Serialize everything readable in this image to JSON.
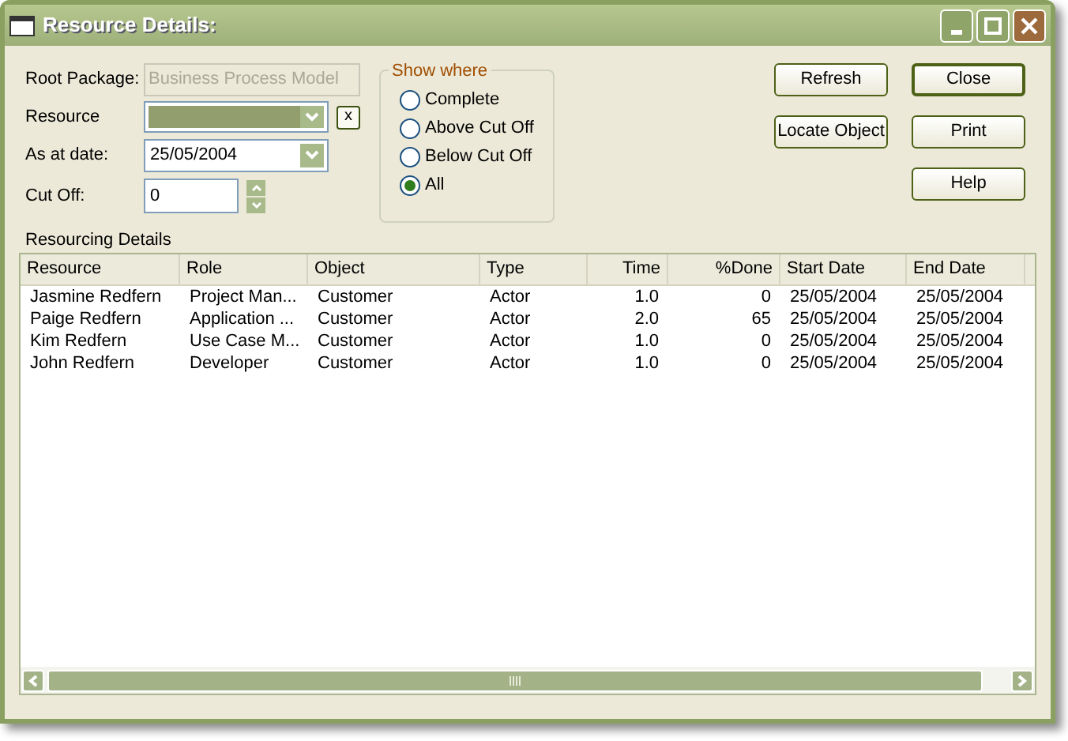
{
  "window": {
    "title": "Resource Details:"
  },
  "root_package": {
    "label": "Root Package:",
    "value": "Business Process Model",
    "disabled": true
  },
  "resource": {
    "label": "Resource",
    "clear_button": "x"
  },
  "as_at_date": {
    "label": "As at date:",
    "value": "25/05/2004"
  },
  "cut_off": {
    "label": "Cut Off:",
    "value": "0"
  },
  "show_where": {
    "title": "Show where",
    "options": [
      {
        "label": "Complete",
        "selected": false
      },
      {
        "label": "Above Cut Off",
        "selected": false
      },
      {
        "label": "Below Cut Off",
        "selected": false
      },
      {
        "label": "All",
        "selected": true
      }
    ]
  },
  "buttons": [
    {
      "label": "Refresh",
      "default": false
    },
    {
      "label": "Close",
      "default": true
    },
    {
      "label": "Locate Object",
      "default": false
    },
    {
      "label": "Print",
      "default": false
    },
    {
      "label": "Help",
      "default": false
    }
  ],
  "section_label": "Resourcing Details",
  "table": {
    "columns": [
      "Resource",
      "Role",
      "Object",
      "Type",
      "Time",
      "%Done",
      "Start Date",
      "End Date"
    ],
    "rows": [
      [
        "Jasmine Redfern",
        "Project Man...",
        "Customer",
        "Actor",
        "1.0",
        "0",
        "25/05/2004",
        "25/05/2004"
      ],
      [
        "Paige Redfern",
        "Application ...",
        "Customer",
        "Actor",
        "2.0",
        "65",
        "25/05/2004",
        "25/05/2004"
      ],
      [
        "Kim Redfern",
        "Use Case M...",
        "Customer",
        "Actor",
        "1.0",
        "0",
        "25/05/2004",
        "25/05/2004"
      ],
      [
        "John Redfern",
        "Developer",
        "Customer",
        "Actor",
        "1.0",
        "0",
        "25/05/2004",
        "25/05/2004"
      ]
    ]
  }
}
